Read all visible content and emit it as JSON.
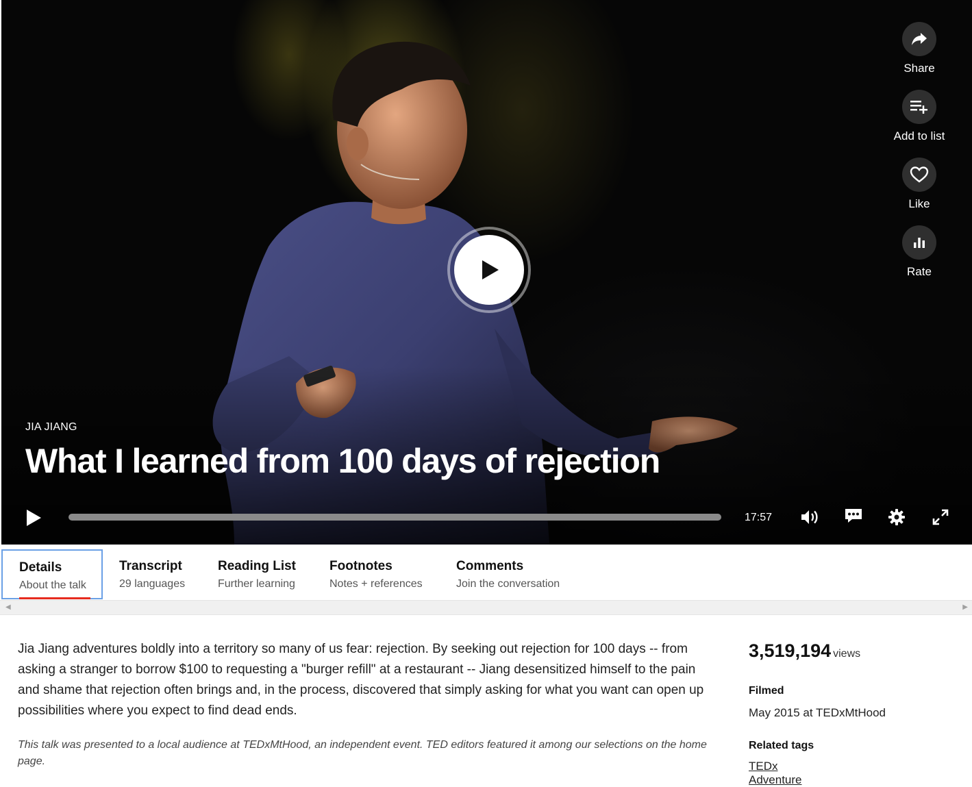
{
  "video": {
    "speaker": "JIA JIANG",
    "title": "What I learned from 100 days of rejection",
    "duration": "17:57",
    "progress_fraction": 0
  },
  "side_actions": {
    "share": "Share",
    "add_to_list": "Add to list",
    "like": "Like",
    "rate": "Rate"
  },
  "tabs": [
    {
      "title": "Details",
      "subtitle": "About the talk"
    },
    {
      "title": "Transcript",
      "subtitle": "29 languages"
    },
    {
      "title": "Reading List",
      "subtitle": "Further learning"
    },
    {
      "title": "Footnotes",
      "subtitle": "Notes + references"
    },
    {
      "title": "Comments",
      "subtitle": "Join the conversation"
    }
  ],
  "details": {
    "description": "Jia Jiang adventures boldly into a territory so many of us fear: rejection. By seeking out rejection for 100 days -- from asking a stranger to borrow $100 to requesting a \"burger refill\" at a restaurant -- Jiang desensitized himself to the pain and shame that rejection often brings and, in the process, discovered that simply asking for what you want can open up possibilities where you expect to find dead ends.",
    "note": "This talk was presented to a local audience at TEDxMtHood, an independent event. TED editors featured it among our selections on the home page.",
    "views_count": "3,519,194",
    "views_label": "views",
    "filmed_heading": "Filmed",
    "filmed_value": "May 2015 at TEDxMtHood",
    "tags_heading": "Related tags",
    "tags": [
      "TEDx",
      "Adventure"
    ]
  },
  "colors": {
    "accent": "#e62b1e",
    "focus_outline": "#6aa0e6"
  }
}
